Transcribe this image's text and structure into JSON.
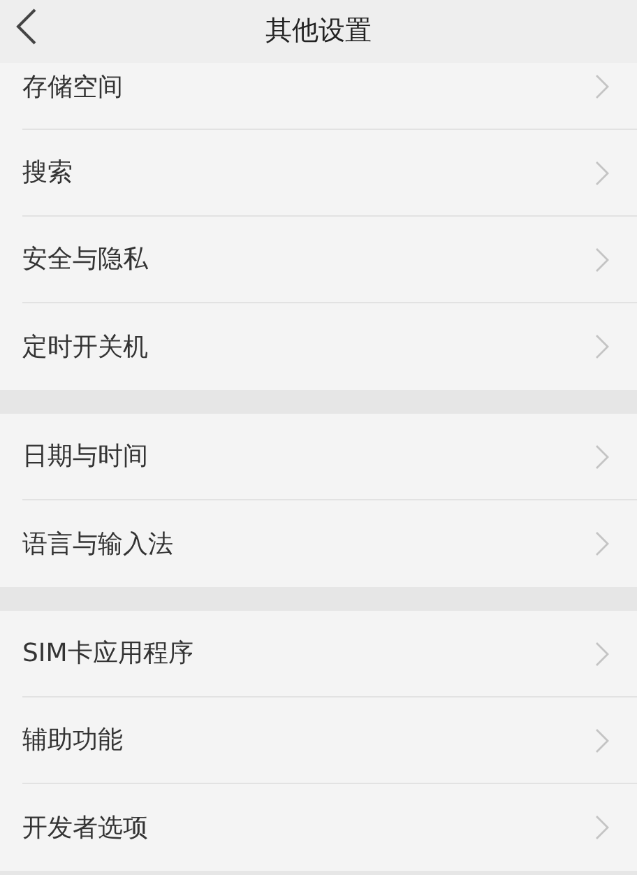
{
  "header": {
    "title": "其他设置"
  },
  "groups": [
    {
      "items": [
        {
          "label": "存储空间"
        },
        {
          "label": "搜索"
        },
        {
          "label": "安全与隐私"
        },
        {
          "label": "定时开关机"
        }
      ]
    },
    {
      "items": [
        {
          "label": "日期与时间"
        },
        {
          "label": "语言与输入法"
        }
      ]
    },
    {
      "items": [
        {
          "label": "SIM卡应用程序"
        },
        {
          "label": "辅助功能"
        },
        {
          "label": "开发者选项"
        }
      ]
    }
  ]
}
